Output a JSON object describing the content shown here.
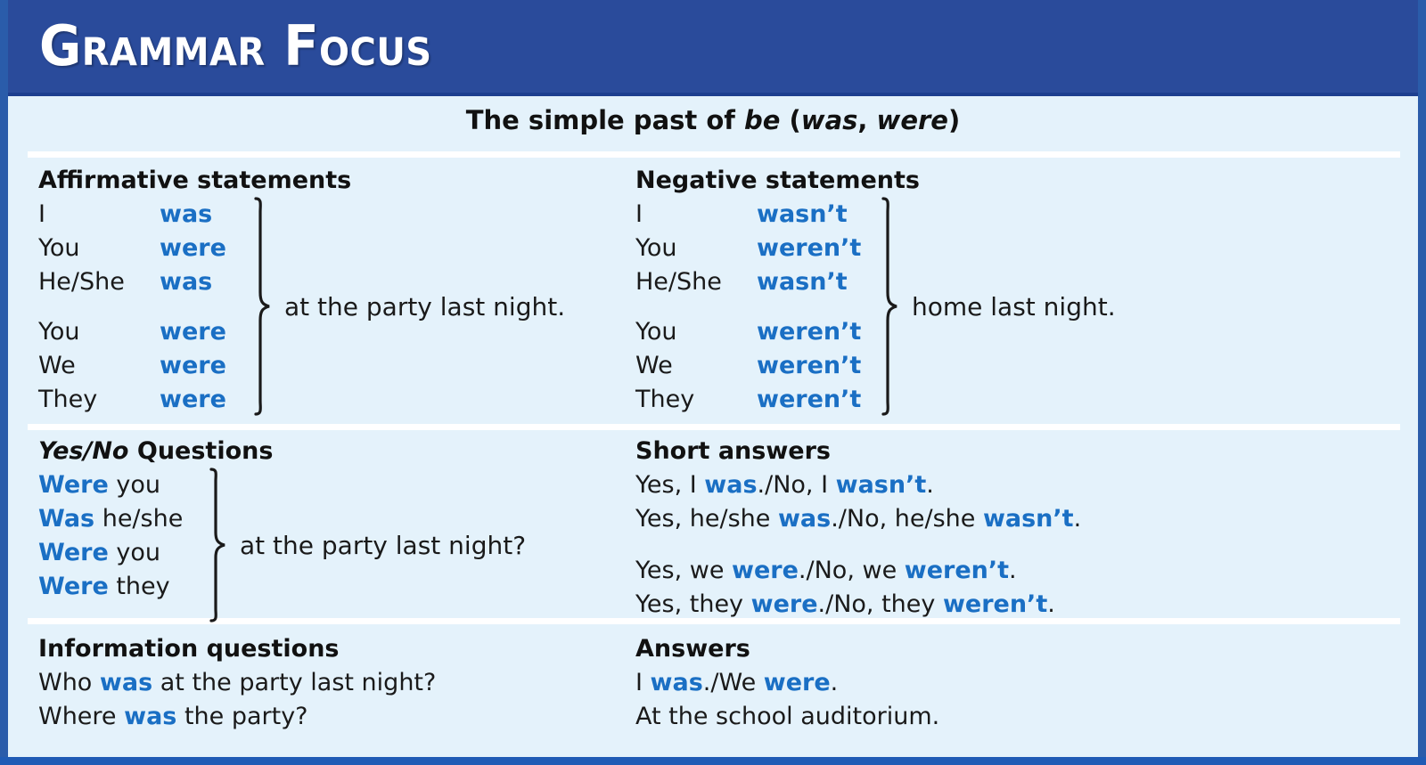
{
  "banner": {
    "title": "Grammar Focus"
  },
  "subtitle": {
    "pre": "The simple past of ",
    "verb": "be",
    "open": " (",
    "form1": "was",
    "comma": ", ",
    "form2": "were",
    "close": ")"
  },
  "sections": [
    {
      "id": "statements",
      "left": {
        "heading": "Affirmative statements",
        "rows": [
          {
            "subject": "I",
            "verb": "was"
          },
          {
            "subject": "You",
            "verb": "were"
          },
          {
            "subject": "He/She",
            "verb": "was"
          },
          {
            "gap": true
          },
          {
            "subject": "You",
            "verb": "were"
          },
          {
            "subject": "We",
            "verb": "were"
          },
          {
            "subject": "They",
            "verb": "were"
          }
        ],
        "predicate": "at the party last night."
      },
      "right": {
        "heading": "Negative statements",
        "rows": [
          {
            "subject": "I",
            "verb": "wasn’t"
          },
          {
            "subject": "You",
            "verb": "weren’t"
          },
          {
            "subject": "He/She",
            "verb": "wasn’t"
          },
          {
            "gap": true
          },
          {
            "subject": "You",
            "verb": "weren’t"
          },
          {
            "subject": "We",
            "verb": "weren’t"
          },
          {
            "subject": "They",
            "verb": "weren’t"
          }
        ],
        "predicate": "home last night."
      }
    },
    {
      "id": "questions",
      "left": {
        "heading_italic": "Yes/No",
        "heading_rest": " Questions",
        "rows": [
          {
            "verb": "Were",
            "subject": " you"
          },
          {
            "verb": "Was",
            "subject": " he/she"
          },
          {
            "gap": true
          },
          {
            "verb": "Were",
            "subject": " you"
          },
          {
            "verb": "Were",
            "subject": " they"
          }
        ],
        "predicate": "at the party last night?"
      },
      "right": {
        "heading": "Short answers",
        "lines": [
          [
            {
              "t": "Yes, I "
            },
            {
              "t": "was",
              "v": true
            },
            {
              "t": "./No, I "
            },
            {
              "t": "wasn’t",
              "v": true
            },
            {
              "t": "."
            }
          ],
          [
            {
              "t": "Yes, he/she "
            },
            {
              "t": "was",
              "v": true
            },
            {
              "t": "./No, he/she "
            },
            {
              "t": "wasn’t",
              "v": true
            },
            {
              "t": "."
            }
          ],
          [
            {
              "gap": true
            }
          ],
          [
            {
              "t": "Yes, we "
            },
            {
              "t": "were",
              "v": true
            },
            {
              "t": "./No, we "
            },
            {
              "t": "weren’t",
              "v": true
            },
            {
              "t": "."
            }
          ],
          [
            {
              "t": "Yes, they "
            },
            {
              "t": "were",
              "v": true
            },
            {
              "t": "./No, they "
            },
            {
              "t": "weren’t",
              "v": true
            },
            {
              "t": "."
            }
          ]
        ]
      }
    },
    {
      "id": "information",
      "left": {
        "heading": "Information questions",
        "lines": [
          [
            {
              "t": "Who "
            },
            {
              "t": "was",
              "v": true
            },
            {
              "t": " at the party last night?"
            }
          ],
          [
            {
              "t": "Where "
            },
            {
              "t": "was",
              "v": true
            },
            {
              "t": " the party?"
            }
          ]
        ]
      },
      "right": {
        "heading": "Answers",
        "lines": [
          [
            {
              "t": "I "
            },
            {
              "t": "was",
              "v": true
            },
            {
              "t": "./We "
            },
            {
              "t": "were",
              "v": true
            },
            {
              "t": "."
            }
          ],
          [
            {
              "t": "At the school auditorium."
            }
          ]
        ]
      }
    }
  ],
  "colors": {
    "banner_blue": "#2a4b9b",
    "accent_blue": "#1a6fc4",
    "sheet_bg": "#e4f2fb",
    "frame_blue": "#2a5caa",
    "text_black": "#1a1a1a"
  }
}
